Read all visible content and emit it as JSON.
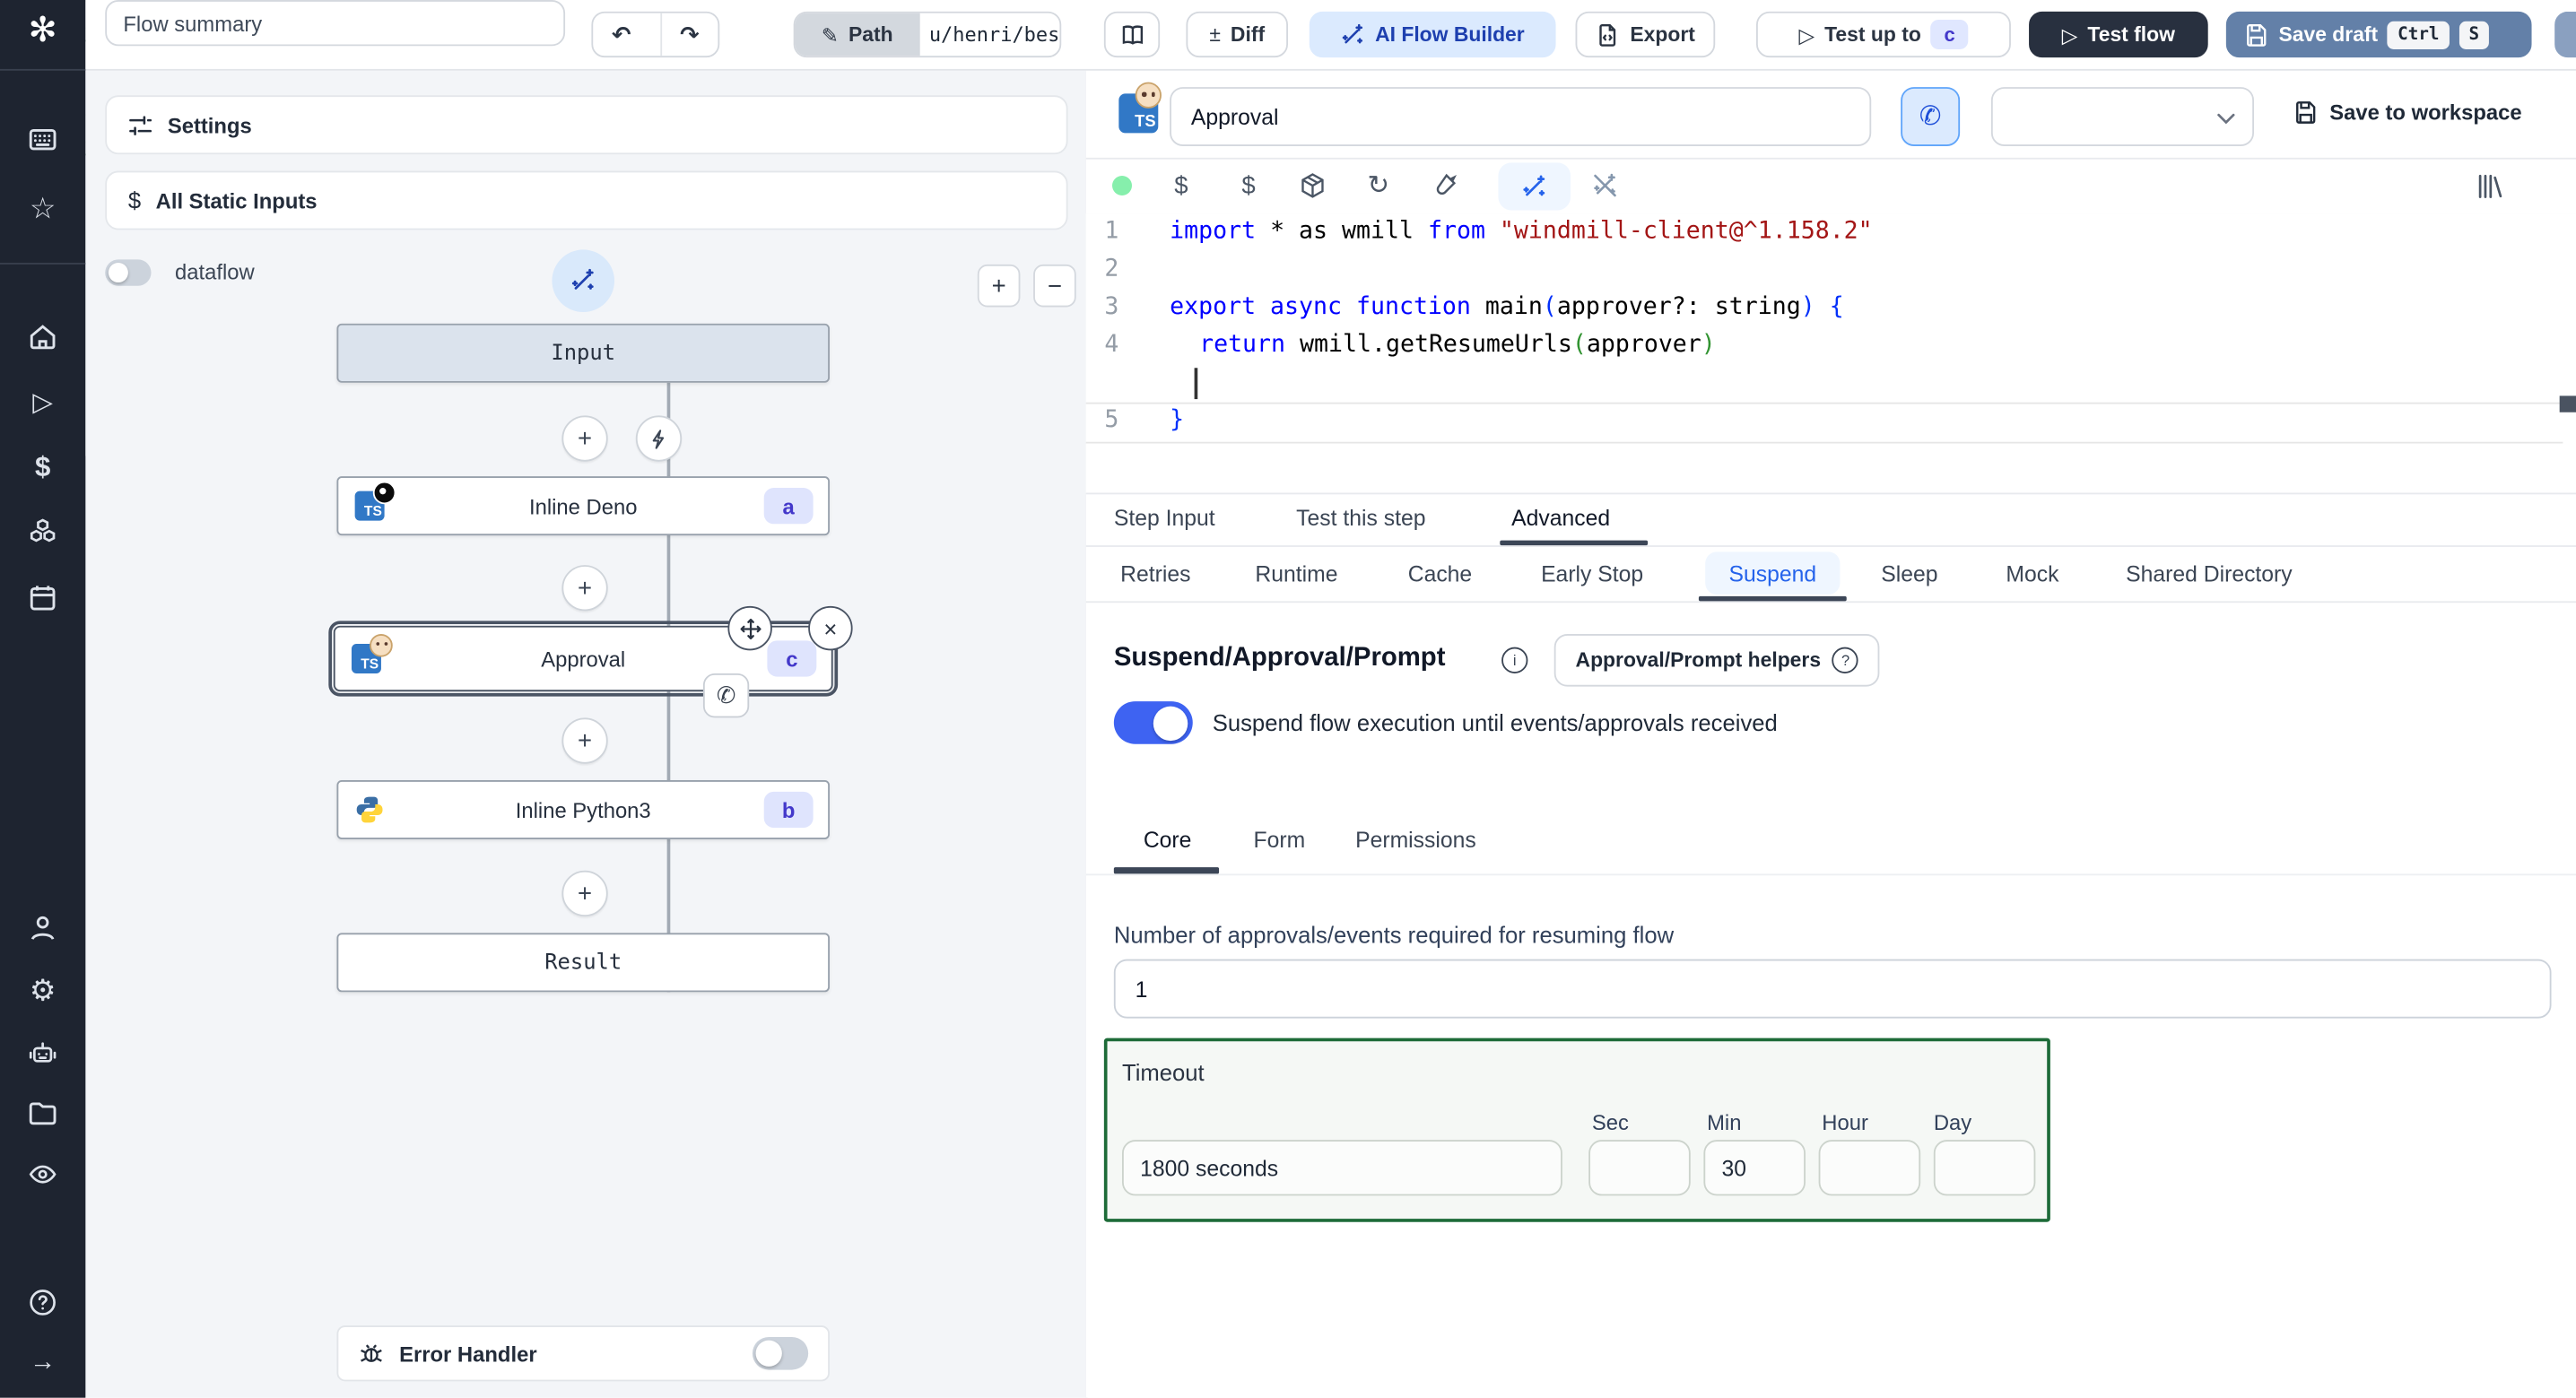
{
  "topbar": {
    "flow_summary": "Flow summary",
    "path": {
      "label": "Path",
      "value": "u/henri/bes"
    },
    "diff_label": "Diff",
    "ai_flow_builder_label": "AI Flow Builder",
    "export_label": "Export",
    "test_up_to_label": "Test up to",
    "test_up_to_badge": "c",
    "test_flow_label": "Test flow",
    "save_draft_label": "Save draft",
    "shortcut": {
      "ctrl": "Ctrl",
      "key": "S"
    }
  },
  "sidebar": {
    "icon_names": [
      "windmill-logo",
      "apps",
      "favorites",
      "home",
      "runs",
      "variables",
      "resources",
      "schedules",
      "users",
      "settings",
      "workers",
      "folders",
      "audit-logs",
      "help",
      "expand"
    ]
  },
  "flow_panel": {
    "settings_label": "Settings",
    "all_static_inputs_label": "All Static Inputs",
    "dataflow_label": "dataflow",
    "zoom_in": "+",
    "zoom_out": "−",
    "ts_label": "TS",
    "nodes": {
      "input": {
        "label": "Input"
      },
      "deno": {
        "label": "Inline Deno",
        "badge": "a"
      },
      "approval": {
        "label": "Approval",
        "badge": "c"
      },
      "python": {
        "label": "Inline Python3",
        "badge": "b"
      },
      "result": {
        "label": "Result"
      }
    },
    "error_handler_label": "Error Handler"
  },
  "step_editor": {
    "name_value": "Approval",
    "save_to_workspace_label": "Save to workspace",
    "line_numbers": [
      "1",
      "2",
      "3",
      "4",
      "5"
    ],
    "code": {
      "l1": {
        "kw1": "import",
        "pl1": " * as wmill ",
        "kw2": "from",
        "str1": " \"windmill-client@^1.158.2\""
      },
      "l3": {
        "kw1": "export async function",
        "pl1": " main",
        "p1": "(",
        "pl2": "approver?: string",
        "p2": ") ",
        "b1": "{"
      },
      "l4": {
        "kw1": "return",
        "pl1": " wmill.getResumeUrls",
        "p1": "(",
        "pl2": "approver",
        "p2": ")"
      },
      "l5": {
        "b1": "}"
      }
    }
  },
  "tabs": {
    "step": [
      "Step Input",
      "Test this step",
      "Advanced"
    ],
    "step_active": "Advanced",
    "advanced": [
      "Retries",
      "Runtime",
      "Cache",
      "Early Stop",
      "Suspend",
      "Sleep",
      "Mock",
      "Shared Directory"
    ],
    "advanced_active": "Suspend"
  },
  "suspend": {
    "title": "Suspend/Approval/Prompt",
    "helpers_button_label": "Approval/Prompt helpers",
    "toggle_label": "Suspend flow execution until events/approvals received",
    "sub_tabs": [
      "Core",
      "Form",
      "Permissions"
    ],
    "sub_tabs_active": "Core",
    "approvals_label": "Number of approvals/events required for resuming flow",
    "approvals_value": "1",
    "timeout": {
      "label": "Timeout",
      "value": "1800 seconds",
      "units": [
        "Sec",
        "Min",
        "Hour",
        "Day"
      ],
      "sec_value": "",
      "min_value": "30",
      "hour_value": "",
      "day_value": ""
    }
  },
  "icons": {
    "undo": "↶",
    "redo": "↷",
    "pencil": "✎",
    "plus_minus": "±",
    "play": "▷",
    "refresh": "↻",
    "gear": "⚙",
    "star": "☆",
    "arrow_right": "→",
    "phone": "✆",
    "close": "×",
    "plus": "+",
    "minus": "−",
    "dollar": "$",
    "question": "?",
    "info": "i",
    "logo": "✻"
  },
  "colors": {
    "sidebar_bg": "#1e2430",
    "accent_blue": "#2563eb",
    "toggle_on": "#3e63f2",
    "badge_bg": "#e0e7ff",
    "badge_text": "#4338ca",
    "timeout_green": "#1d6b38",
    "test_flow_bg": "#28303f",
    "save_draft_bg": "#6380a8",
    "ai_builder_bg": "#dbeafe",
    "ai_builder_text": "#1e40af",
    "code_keyword": "#0000ff",
    "code_string": "#a31515",
    "status_dot": "#86efac"
  }
}
